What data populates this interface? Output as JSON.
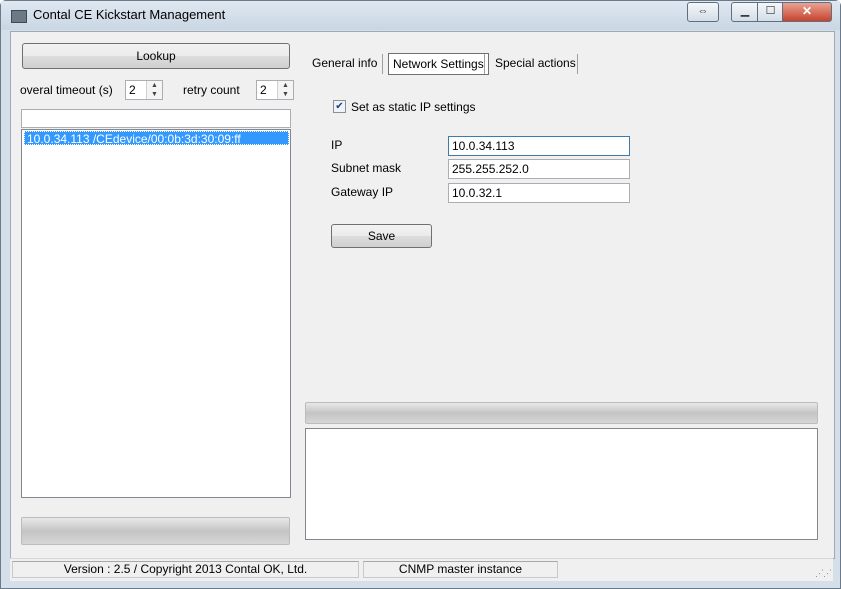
{
  "window": {
    "title": "Contal CE Kickstart Management",
    "extra_button_icon": "window-switch-icon",
    "minimize_icon": "minimize-icon",
    "maximize_icon": "maximize-icon",
    "close_icon": "close-icon",
    "extra_symbol": "⇔",
    "min_symbol": "▁",
    "max_symbol": "☐",
    "close_symbol": "✕"
  },
  "left": {
    "lookup_label": "Lookup",
    "timeout_label": "overal timeout (s)",
    "timeout_value": "2",
    "retry_label": "retry count",
    "retry_value": "2",
    "filter_value": "",
    "devices": [
      "10.0.34.113 /CEdevice/00:0b:3d:30:09:ff"
    ],
    "selected_device_index": 0
  },
  "tabs": {
    "general": "General info",
    "network": "Network Settings",
    "special": "Special actions",
    "active": "network"
  },
  "network": {
    "static_ip_label": "Set as static IP settings",
    "static_ip_checked": true,
    "ip_label": "IP",
    "ip_value": "10.0.34.113",
    "subnet_label": "Subnet mask",
    "subnet_value": "255.255.252.0",
    "gateway_label": "Gateway IP",
    "gateway_value": "10.0.32.1",
    "save_label": "Save"
  },
  "output": {
    "text": ""
  },
  "statusbar": {
    "version": "Version : 2.5 / Copyright 2013 Contal OK, Ltd.",
    "instance": "CNMP master instance"
  },
  "colors": {
    "titlebar": "#c9d6e3",
    "selection": "#3399ff",
    "close_button": "#c7432c"
  }
}
